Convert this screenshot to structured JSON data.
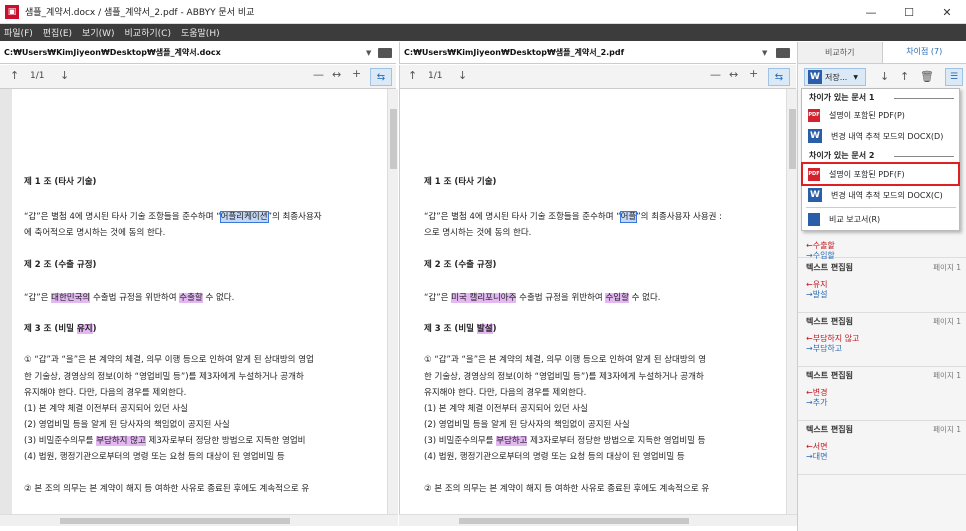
{
  "window": {
    "title": "샘플_계약서.docx / 샘플_계약서_2.pdf - ABBYY 문서 비교",
    "app_icon": "abbyy-logo",
    "controls": [
      "—",
      "☐",
      "✕"
    ]
  },
  "menu": [
    "파일(F)",
    "편집(E)",
    "보기(W)",
    "비교하기(C)",
    "도움말(H)"
  ],
  "left": {
    "path": "C:₩Users₩KimJiyeon₩Desktop₩샘플_계약서.docx",
    "page": "1/1",
    "lines": [
      {
        "t": "제 1 조 (타사 기술)",
        "b": true
      },
      {
        "segs": [
          "“갑”은 별첨 4에 명시된 타사 기술 조항들을 준수하며 “",
          "어플리케이션",
          "”의 최종사용자"
        ],
        "mark": "blue"
      },
      {
        "t": "에 축어적으로 명시하는 것에 동의 한다."
      },
      {
        "t": "제 2 조 (수출 규정)",
        "b": true
      },
      {
        "segs": [
          "“갑”은 ",
          "대한민국의",
          " 수출법 규정을 위반하여 ",
          "수출할",
          " 수 없다."
        ],
        "mark": "purple"
      },
      {
        "segs": [
          "제 3 조 (비밀 ",
          "유지",
          ")"
        ],
        "b": true,
        "mark": "purple"
      },
      {
        "t": "①   “갑”과 “을”은 본 계약의 체결, 의무 이행 등으로 인하여 알게 된 상대방의 영업"
      },
      {
        "t": "     한 기술상, 경영상의 정보(이하 “영업비밀 등”)를 제3자에게 누설하거나 공개하"
      },
      {
        "t": "     유지해야 한다. 다만, 다음의 경우를 제외한다."
      },
      {
        "t": "     (1)  본 계약 체결 이전부터 공지되어 있던 사실"
      },
      {
        "t": "     (2)  영업비밀 등을 알게 된 당사자의 책임없이 공지된 사실"
      },
      {
        "segs": [
          "     (3)  비밀준수의무를 ",
          "부담하지 않고",
          " 제3자로부터 정당한 방법으로 지득한 영업비"
        ],
        "mark": "purple"
      },
      {
        "t": "     (4)  법원, 행정기관으로부터의 명령 또는 요청 등의 대상이 된 영업비밀 등"
      },
      {
        "t": "②   본 조의 의무는 본 계약이 해지 등 여하한 사유로 종료된 후에도 계속적으로 유"
      }
    ]
  },
  "right": {
    "path": "C:₩Users₩KimJiyeon₩Desktop₩샘플_계약서_2.pdf",
    "page": "1/1",
    "lines": [
      {
        "t": "제 1 조 (타사 기술)",
        "b": true
      },
      {
        "segs": [
          "“갑”은 별첨 4에 명시된 타사 기술 조항들을 준수하며 “",
          "어플",
          "”의 최종사용자 사용권 :"
        ],
        "mark": "blue"
      },
      {
        "t": "으로 명시하는 것에 동의 한다."
      },
      {
        "t": "제 2 조 (수출 규정)",
        "b": true
      },
      {
        "segs": [
          "“갑”은 ",
          "미국 캘리포니아주",
          " 수출법 규정을 위반하여 ",
          "수입할",
          " 수 없다."
        ],
        "mark": "purple"
      },
      {
        "segs": [
          "제 3 조 (비밀 ",
          "발설",
          ")"
        ],
        "b": true,
        "mark": "purple"
      },
      {
        "t": "①   “갑”과 “을”은 본 계약의 체결, 의무 이행 등으로 인하여 알게 된 상대방의 영"
      },
      {
        "t": "     한 기술상, 경영상의 정보(이하 “영업비밀 등”)를 제3자에게 누설하거나 공개하"
      },
      {
        "t": "     유지해야 한다. 다만, 다음의 경우를 제외한다."
      },
      {
        "t": "     (1)  본 계약 체결 이전부터 공지되어 있던 사실"
      },
      {
        "t": "     (2)  영업비밀 등을 알게 된 당사자의 책임없이 공지된 사실"
      },
      {
        "segs": [
          "     (3)  비밀준수의무를 ",
          "부담하고",
          " 제3자로부터 정당한 방법으로 지득한 영업비밀 등"
        ],
        "mark": "purple"
      },
      {
        "t": "     (4)  법원, 행정기관으로부터의 명령 또는 요청 등의 대상이 된 영업비밀 등"
      },
      {
        "t": "②   본 조의 의무는 본 계약이 해지 등 여하한 사유로 종료된 후에도 계속적으로 유"
      }
    ]
  },
  "sidebar": {
    "tabs": [
      "비교하기",
      "차이점 (7)"
    ],
    "save_label": "저장...",
    "dropdown": {
      "group1": "차이가 있는 문서 1",
      "group2": "차이가 있는 문서 2",
      "items1": [
        "설명이 포함된 PDF(P)",
        "변경 내역 추적 모드의 DOCX(D)"
      ],
      "items2": [
        "설명이 포함된 PDF(F)",
        "변경 내역 추적 모드의 DOCX(C)"
      ],
      "report": "비교 보고서(R)"
    },
    "changes": [
      {
        "title": "",
        "page": "",
        "del": "←수출할",
        "ins": "→수입할"
      },
      {
        "title": "텍스트 편집됨",
        "page": "페이지 1",
        "del": "←유지",
        "ins": "→발설"
      },
      {
        "title": "텍스트 편집됨",
        "page": "페이지 1",
        "del": "←부담하지 않고",
        "ins": "→부담하고"
      },
      {
        "title": "텍스트 편집됨",
        "page": "페이지 1",
        "del": "←변경",
        "ins": "→추가"
      },
      {
        "title": "텍스트 편집됨",
        "page": "페이지 1",
        "del": "←서면",
        "ins": "→대면"
      }
    ]
  }
}
